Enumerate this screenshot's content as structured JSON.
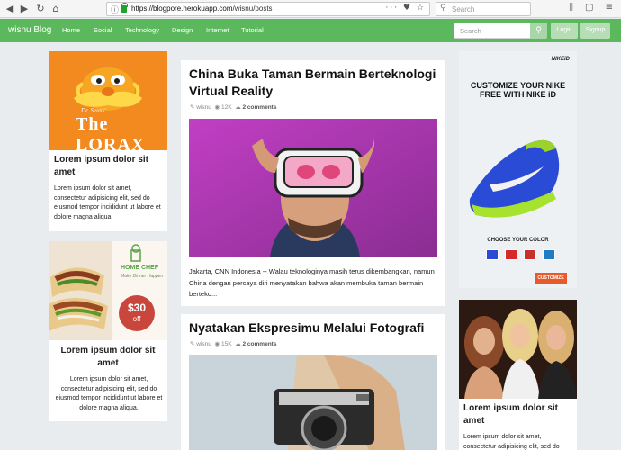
{
  "browser": {
    "url_host": "https://blogpore.herokuapp.com",
    "url_path": "/wisnu/posts",
    "search_placeholder": "Search"
  },
  "navbar": {
    "brand": "wisnu Blog",
    "links": [
      "Home",
      "Social",
      "Technology",
      "Design",
      "Internet",
      "Tutorial"
    ],
    "search_placeholder": "Search",
    "login": "Login",
    "signup": "Signup"
  },
  "sidebar_left": [
    {
      "title": "Lorem ipsum dolor sit amet",
      "body": "Lorem ipsum dolor sit amet, consectetur adipisicing elit, sed do eiusmod tempor incididunt ut labore et dolore magna aliqua.",
      "image_text": "The LORAX"
    },
    {
      "title": "Lorem ipsum dolor sit amet",
      "body": "Lorem ipsum dolor sit amet, consectetur adipisicing elit, sed do eiusmod tempor incididunt ut labore et dolore magna aliqua.",
      "brand": "HOME CHEF",
      "brand_sub": "Make Dinner Happen",
      "price": "$30",
      "price_sub": "off"
    }
  ],
  "posts": [
    {
      "title": "China Buka Taman Bermain Berteknologi Virtual Reality",
      "author": "wisnu",
      "views": "12K",
      "comments": "2 comments",
      "excerpt": "Jakarta, CNN Indonesia -- Walau teknologinya masih terus dikembangkan, namun China dengan percaya diri menyatakan bahwa akan membuka taman bermain berteko..."
    },
    {
      "title": "Nyatakan Ekspresimu Melalui Fotografi",
      "author": "wisnu",
      "views": "15K",
      "comments": "2 comments"
    }
  ],
  "ad_right": {
    "brand": "NIKEiD",
    "headline": "CUSTOMIZE YOUR NIKE FREE WITH NIKE iD",
    "choose": "CHOOSE YOUR COLOR",
    "cta": "CUSTOMIZE"
  },
  "sidebar_right": [
    {
      "title": "Lorem ipsum dolor sit amet",
      "body": "Lorem ipsum dolor sit amet, consectetur adipisicing elit, sed do"
    }
  ]
}
